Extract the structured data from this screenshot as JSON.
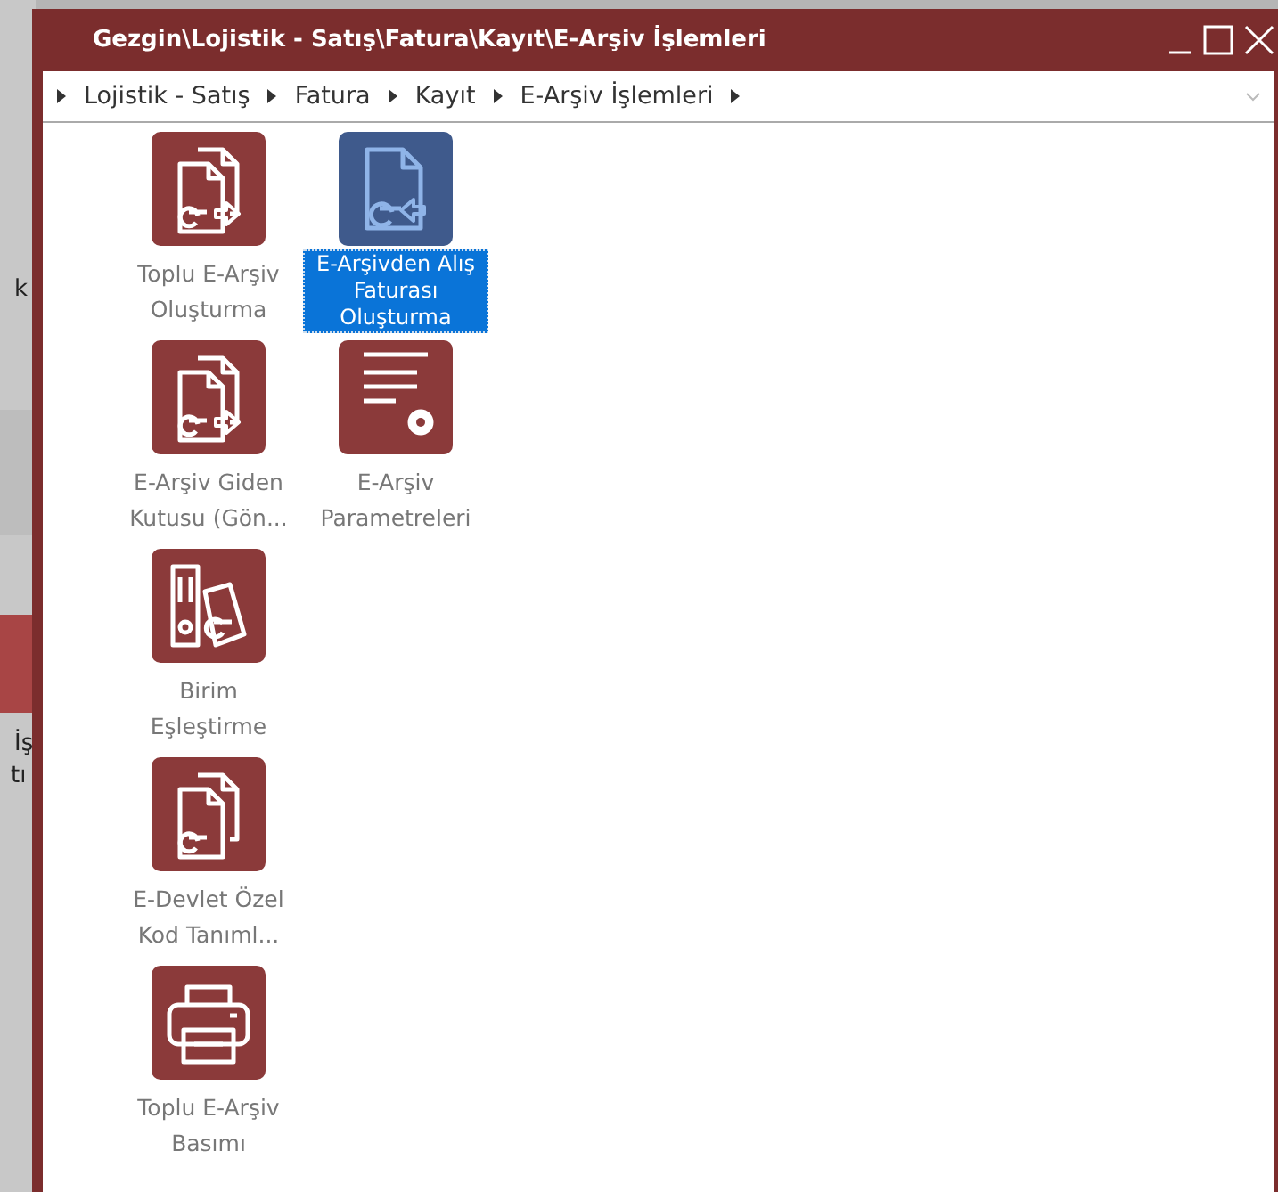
{
  "background_fragments": [
    "k",
    "İş",
    "tı"
  ],
  "window": {
    "title": "Gezgin\\Lojistik - Satış\\Fatura\\Kayıt\\E-Arşiv İşlemleri"
  },
  "breadcrumb": [
    "Lojistik - Satış",
    "Fatura",
    "Kayıt",
    "E-Arşiv İşlemleri"
  ],
  "rows": [
    [
      {
        "label": "Toplu E-Arşiv Oluşturma",
        "selected": false
      },
      {
        "label": "E-Arşivden Alış Faturası Oluşturma",
        "selected": true
      }
    ],
    [
      {
        "label": "E-Arşiv Giden Kutusu (Gön...",
        "selected": false
      },
      {
        "label": "E-Arşiv Parametreleri",
        "selected": false
      }
    ],
    [
      {
        "label": "Birim Eşleştirme",
        "selected": false
      }
    ],
    [
      {
        "label": "E-Devlet Özel Kod Tanıml...",
        "selected": false
      }
    ],
    [
      {
        "label": "Toplu E-Arşiv Basımı",
        "selected": false
      }
    ]
  ]
}
